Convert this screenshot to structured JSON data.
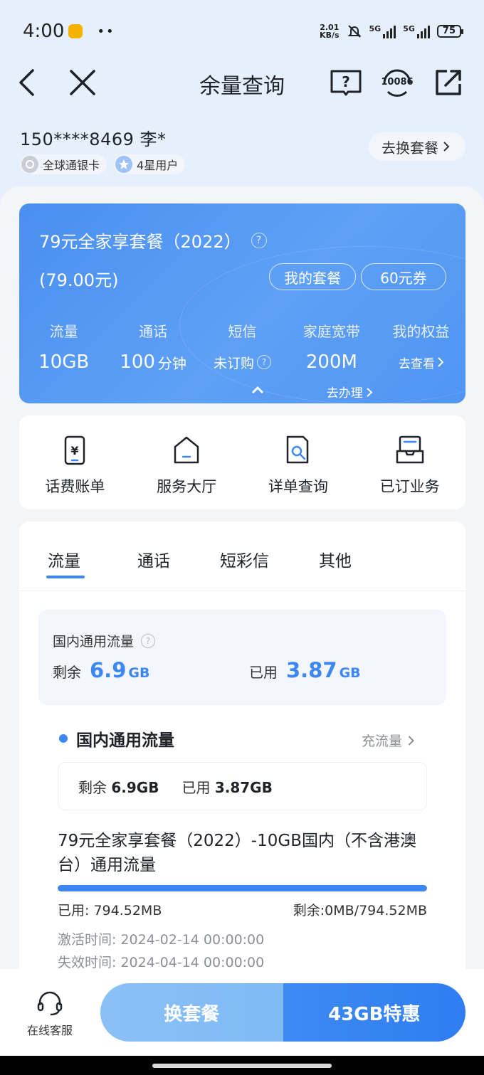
{
  "status": {
    "time": "4:00",
    "dots": "••",
    "net_speed_value": "2.01",
    "net_speed_unit": "KB/s",
    "sig1_label": "5G",
    "sig2_label": "5G",
    "battery": "75"
  },
  "nav": {
    "title": "余量查询",
    "hotline": "10086"
  },
  "user": {
    "phone": "150****8469 李*",
    "tags": [
      "全球通银卡",
      "4星用户"
    ],
    "change_plan": "去换套餐"
  },
  "plan": {
    "name": "79元全家享套餐（2022）",
    "price": "(79.00元)",
    "my_plan_btn": "我的套餐",
    "coupon_btn": "60元券",
    "stats": [
      {
        "label": "流量",
        "value": "10GB",
        "unit": ""
      },
      {
        "label": "通话",
        "value": "100",
        "unit": "分钟"
      },
      {
        "label": "短信",
        "value": "未订购",
        "unit": ""
      },
      {
        "label": "家庭宽带",
        "value": "200M",
        "unit": ""
      },
      {
        "label": "我的权益",
        "value": "去查看",
        "unit": ""
      }
    ],
    "go_handle": "去办理"
  },
  "shortcuts": [
    {
      "label": "话费账单",
      "icon": "phone-bill-icon"
    },
    {
      "label": "服务大厅",
      "icon": "home-icon"
    },
    {
      "label": "详单查询",
      "icon": "document-search-icon"
    },
    {
      "label": "已订业务",
      "icon": "inbox-icon"
    }
  ],
  "tabs": [
    "流量",
    "通话",
    "短彩信",
    "其他"
  ],
  "summary": {
    "title": "国内通用流量",
    "remain_label": "剩余",
    "remain_value": "6.9",
    "remain_unit": "GB",
    "used_label": "已用",
    "used_value": "3.87",
    "used_unit": "GB"
  },
  "section": {
    "title": "国内通用流量",
    "recharge": "充流量",
    "remain_label": "剩余",
    "remain_value": "6.9GB",
    "used_label": "已用",
    "used_value": "3.87GB"
  },
  "package": {
    "title": "79元全家享套餐（2022）-10GB国内（不含港澳台）通用流量",
    "used": "已用: 794.52MB",
    "remain": "剩余:0MB/794.52MB",
    "progress_fraction": 1.0,
    "activate": "激活时间: 2024-02-14 00:00:00",
    "expire": "失效时间: 2024-04-14 00:00:00"
  },
  "bottom": {
    "service": "在线客服",
    "change_plan": "换套餐",
    "offer": "43GB特惠"
  },
  "colors": {
    "accent": "#3d87f5",
    "card_blue": "#4a8ff0",
    "page_bg": "#e6f0fc"
  }
}
